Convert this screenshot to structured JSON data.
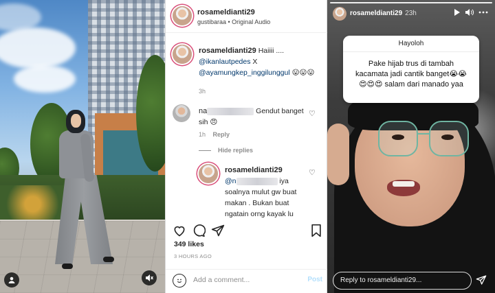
{
  "post": {
    "header": {
      "username": "rosameldianti29",
      "subtitle": "gustibaraa • Original Audio"
    },
    "caption": {
      "username": "rosameldianti29",
      "text_1": "Haiiii ....",
      "mention_1": "@ikanlautpedes",
      "text_2": " X",
      "mention_2": "@ayamungkep_inggilunggul",
      "emoji": " 😛😛😛",
      "time": "3h"
    },
    "comment": {
      "username_prefix": "na",
      "text": "Gendut banget sih 😠",
      "time": "1h",
      "reply_label": "Reply",
      "hide_replies": "Hide replies"
    },
    "reply": {
      "username": "rosameldianti29",
      "mention_prefix": "@n",
      "text": " iya soalnya mulut gw buat makan . Bukan buat ngatain orng kayak lu"
    },
    "likes": "349 likes",
    "posted": "3 HOURS AGO",
    "comment_placeholder": "Add a comment...",
    "post_button": "Post"
  },
  "story": {
    "username": "rosameldianti29",
    "time": "23h",
    "question_title": "Hayoloh",
    "answer": "Pake hijab trus di tambah kacamata jadi cantik banget😭😭 😍😍😍 salam dari manado yaa",
    "reply_placeholder": "Reply to rosameldianti29..."
  },
  "icons": {
    "photo_user": "user-circle-icon",
    "photo_mute": "speaker-muted-icon",
    "like": "heart-outline-icon",
    "comment": "comment-bubble-icon",
    "share": "paper-plane-icon",
    "save": "bookmark-icon",
    "emoji": "smiley-icon",
    "story_play": "play-icon",
    "story_sound": "speaker-icon",
    "story_more": "more-dots-icon",
    "story_send": "paper-plane-icon"
  },
  "colors": {
    "mention": "#00376b",
    "post_button": "#b2dffc",
    "story_ring": "#d94f7a"
  }
}
